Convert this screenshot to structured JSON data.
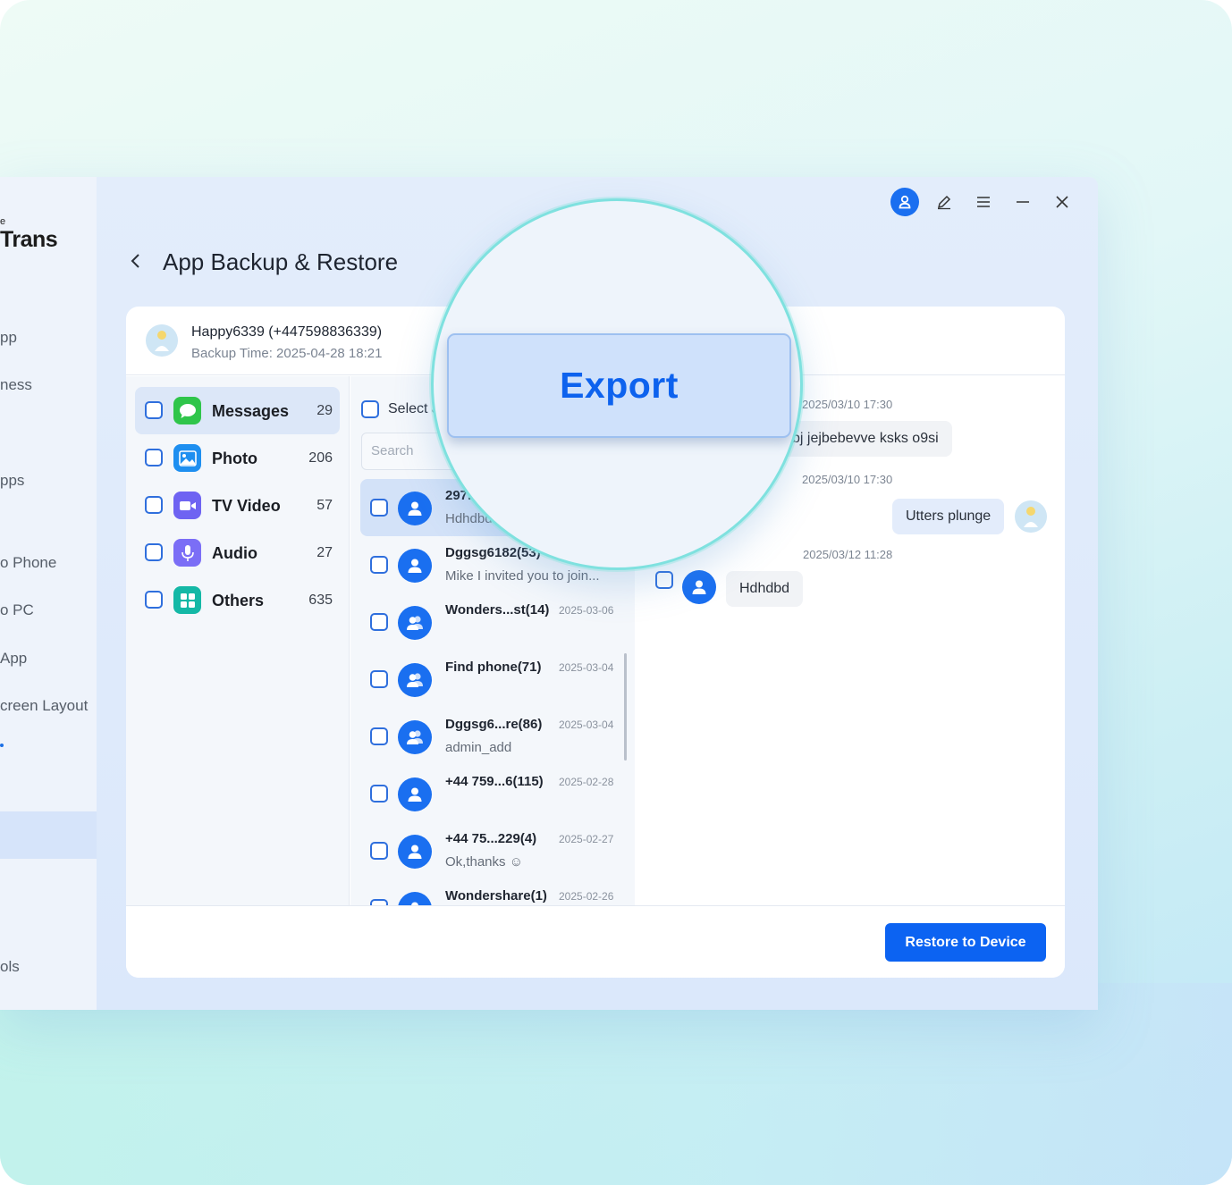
{
  "app": {
    "brand_small": "e",
    "brand": "Trans",
    "page_title": "App Backup & Restore"
  },
  "sidebar": {
    "items": [
      {
        "label": "pp"
      },
      {
        "label": "ness"
      },
      {
        "label": "pps"
      },
      {
        "label": "o Phone"
      },
      {
        "label": "o PC"
      },
      {
        "label": "App"
      },
      {
        "label": "creen Layout"
      },
      {
        "label": "ols"
      }
    ]
  },
  "backup": {
    "account": "Happy6339 (+447598836339)",
    "backup_time": "Backup Time: 2025-04-28 18:21"
  },
  "categories": [
    {
      "label": "Messages",
      "count": "29",
      "icon": "messages-icon",
      "color": "#2fc54a"
    },
    {
      "label": "Photo",
      "count": "206",
      "icon": "photo-icon",
      "color": "#1e8ff0"
    },
    {
      "label": "TV Video",
      "count": "57",
      "icon": "video-icon",
      "color": "#6e63f2"
    },
    {
      "label": "Audio",
      "count": "27",
      "icon": "audio-icon",
      "color": "#7b6ef6"
    },
    {
      "label": "Others",
      "count": "635",
      "icon": "others-icon",
      "color": "#14b8a6"
    }
  ],
  "list": {
    "select_all": "Select a",
    "search_placeholder": "Search",
    "conversations": [
      {
        "name": "297...",
        "date": "",
        "preview": "Hdhdbd",
        "group": false
      },
      {
        "name": "Dggsg6182(53)",
        "date": "",
        "preview": "Mike I invited you to join...",
        "group": false
      },
      {
        "name": "Wonders...st(14)",
        "date": "2025-03-06",
        "preview": "",
        "group": true
      },
      {
        "name": "Find phone(71)",
        "date": "2025-03-04",
        "preview": "",
        "group": true
      },
      {
        "name": "Dggsg6...re(86)",
        "date": "2025-03-04",
        "preview": "admin_add",
        "group": true
      },
      {
        "name": "+44 759...6(115)",
        "date": "2025-02-28",
        "preview": "",
        "group": false
      },
      {
        "name": "+44 75...229(4)",
        "date": "2025-02-27",
        "preview": "Ok,thanks ☺",
        "group": false
      },
      {
        "name": "Wondershare(1)",
        "date": "2025-02-26",
        "preview": "",
        "group": false
      }
    ]
  },
  "chat": {
    "messages": [
      {
        "time": "2025/03/10 17:30",
        "text": "bj jejbebevve ksks o9si",
        "side": "in"
      },
      {
        "time": "2025/03/10 17:30",
        "text": "Utters plunge",
        "side": "out"
      },
      {
        "time": "2025/03/12 11:28",
        "text": "Hdhdbd",
        "side": "in"
      }
    ]
  },
  "footer": {
    "restore_label": "Restore to Device"
  },
  "overlay": {
    "export_label": "Export"
  },
  "colors": {
    "accent": "#0c63f2",
    "magnifier_ring": "#7fe1df"
  }
}
